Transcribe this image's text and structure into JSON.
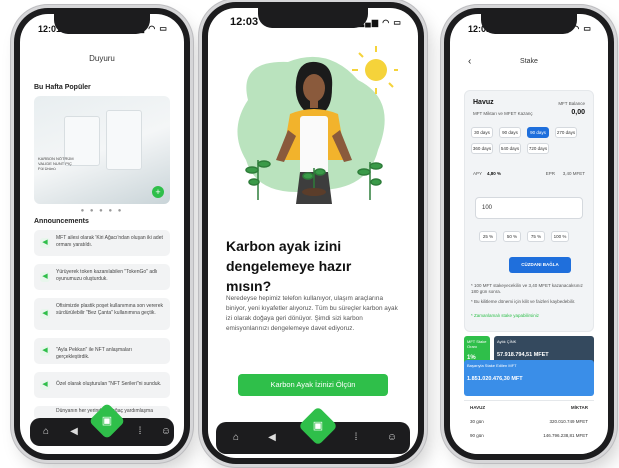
{
  "phone1": {
    "status": {
      "time": "12:01",
      "icons": "▂▄▆ ◠ ▭"
    },
    "title": "Duyuru",
    "popular_title": "Bu Hafta Popüler",
    "banner": {
      "label": "KARBON NÖTRÜM VALIDE NUNT PIÇ Fül Ürünü"
    },
    "carousel_dots": "● ● ● ● ●",
    "announcements_title": "Announcements",
    "announcements": [
      "MFT ailesi olarak 'Kiri Ağacı'ndan oluşan iki adet ormanı yaratıldı.",
      "Yürüyerek token kazanılabilen \"TokenGo\" adlı oyunumuzu oluşturduk.",
      "Ofisimizde plastik poşet kullanımına son vererek sürdürülebilir \"Bez Çanta\" kullanımına geçtik.",
      "\"Ayla Pekkan\" ile NFT anlaşmaları gerçekleştirdik.",
      "Özel olarak oluşturulan \"NFT Serileri\"ni sunduk.",
      "Dünyanın her yerinde bir ağaç yardımlaşma"
    ]
  },
  "phone2": {
    "status": {
      "time": "12:03",
      "icons": "▂▄▆ ◠ ▭"
    },
    "headline": "Karbon ayak izini dengelemeye hazır mısın?",
    "body": "Neredeyse hepimiz telefon kullanıyor, ulaşım araçlarına biniyor, yeni kıyafetler alıyoruz. Tüm bu süreçler karbon ayak izi olarak doğaya geri dönüyor. Şimdi sizi karbon emisyonlarınızı dengelemeye davet ediyoruz.",
    "cta": "Karbon Ayak İzinizi Ölçün"
  },
  "phone3": {
    "status": {
      "time": "12:01",
      "icons": "▂▄▆ ◠ ▭"
    },
    "back": "‹",
    "title": "Stake",
    "pool": {
      "name": "Havuz",
      "subtitle": "MFT Miktarı ve MFET Kazanç",
      "balance_label": "MFT Balance",
      "balance_value": "0,00",
      "durations": [
        "30 days",
        "90 days",
        "90 days",
        "270 days",
        "360 days",
        "540 days",
        "720 days"
      ],
      "selected_duration": "90 days",
      "apy_label": "APY",
      "apy_value": "4,80 %",
      "epr_label": "EPR",
      "epr_value": "3,40 MFET",
      "amount": "100",
      "percents": [
        "25 %",
        "50 %",
        "75 %",
        "100 %"
      ],
      "wallet_button": "CÜZDANI BAĞLA",
      "note1": "* 100 MFT stakeyecekilin ve 3,40 MFET kazanacaksınız 180 gün sonra.",
      "note2": "* Bu kilitleme dönemi için kilit ve faizleri kaybedebilir.",
      "note3": "* Zamanlamalı stake yapabilirsiniz"
    },
    "stats": [
      {
        "label": "MFT Stake Oranı",
        "value": "1%"
      },
      {
        "label": "Aylık ÇİNK",
        "value": "57.918.794,51 MFET"
      },
      {
        "label": "Başarıyla Stake Edilen MFT",
        "value": "1.851.020.476,30 MFT"
      }
    ],
    "table": {
      "header": [
        "HAVUZ",
        "MİKTAR"
      ],
      "rows": [
        {
          "pool": "30 gün",
          "amount": "320.010.749 MFET"
        },
        {
          "pool": "90 gün",
          "amount": "146.796.238,81 MFET"
        }
      ]
    }
  },
  "colors": {
    "accent_green": "#2fbf4a",
    "accent_blue": "#1f6fdc",
    "dark": "#1c1c1e"
  },
  "tab_icons": [
    "home-icon",
    "megaphone-icon",
    "wallet-icon",
    "footprint-icon",
    "user-icon"
  ]
}
